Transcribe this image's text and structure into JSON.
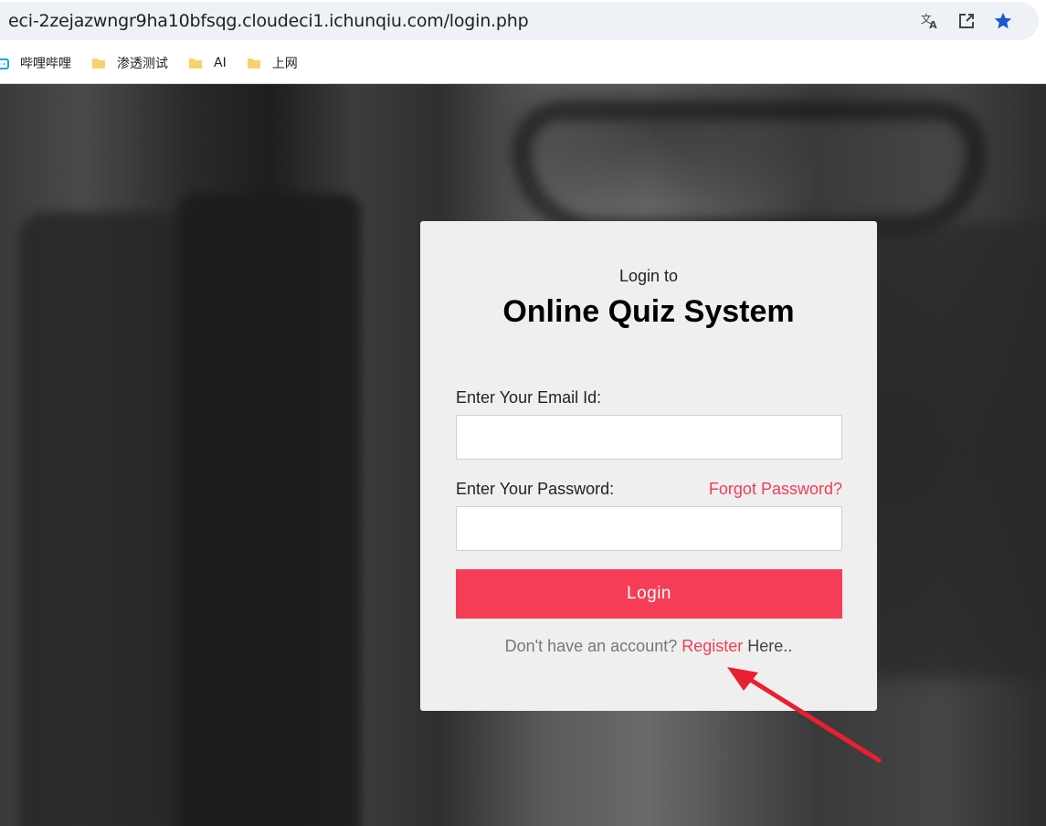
{
  "browser": {
    "url": "eci-2zejazwngr9ha10bfsqg.cloudeci1.ichunqiu.com/login.php",
    "icons": [
      "translate-icon",
      "share-icon",
      "bookmark-star-icon"
    ],
    "bookmarks": [
      "哔哩哔哩",
      "渗透测试",
      "AI",
      "上网"
    ]
  },
  "login": {
    "subtitle": "Login to",
    "title": "Online Quiz System",
    "email_label": "Enter Your Email Id:",
    "email_value": "",
    "password_label": "Enter Your Password:",
    "password_value": "",
    "forgot_link": "Forgot Password?",
    "button_label": "Login",
    "no_account_text": "Don't have an account?",
    "register_link": "Register",
    "here_text": "Here.."
  },
  "colors": {
    "accent": "#f53e55",
    "card_bg": "#efefef",
    "star": "#1a56d6"
  },
  "annotation": {
    "type": "red-arrow",
    "points_to": "register-link"
  }
}
